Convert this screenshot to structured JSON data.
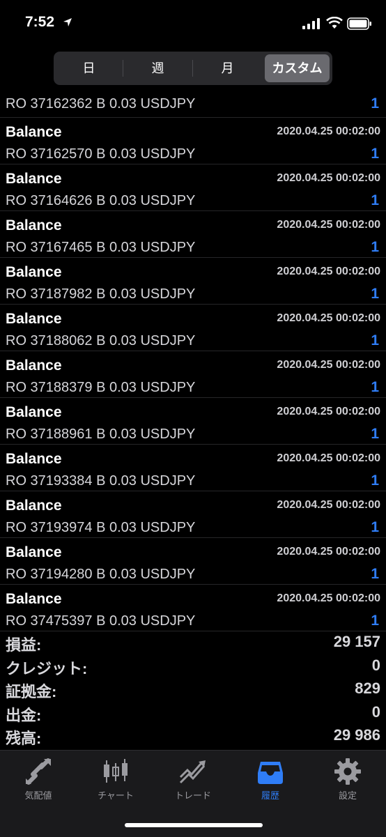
{
  "status": {
    "time": "7:52"
  },
  "segments": [
    {
      "label": "日"
    },
    {
      "label": "週"
    },
    {
      "label": "月"
    },
    {
      "label": "カスタム",
      "selected": true
    }
  ],
  "first_row": {
    "deal": "RO 37162362 B 0.03 USDJPY",
    "count": "1"
  },
  "rows": [
    {
      "title": "Balance",
      "time": "2020.04.25 00:02:00",
      "deal": "RO 37162570 B 0.03 USDJPY",
      "count": "1"
    },
    {
      "title": "Balance",
      "time": "2020.04.25 00:02:00",
      "deal": "RO 37164626 B 0.03 USDJPY",
      "count": "1"
    },
    {
      "title": "Balance",
      "time": "2020.04.25 00:02:00",
      "deal": "RO 37167465 B 0.03 USDJPY",
      "count": "1"
    },
    {
      "title": "Balance",
      "time": "2020.04.25 00:02:00",
      "deal": "RO 37187982 B 0.03 USDJPY",
      "count": "1"
    },
    {
      "title": "Balance",
      "time": "2020.04.25 00:02:00",
      "deal": "RO 37188062 B 0.03 USDJPY",
      "count": "1"
    },
    {
      "title": "Balance",
      "time": "2020.04.25 00:02:00",
      "deal": "RO 37188379 B 0.03 USDJPY",
      "count": "1"
    },
    {
      "title": "Balance",
      "time": "2020.04.25 00:02:00",
      "deal": "RO 37188961 B 0.03 USDJPY",
      "count": "1"
    },
    {
      "title": "Balance",
      "time": "2020.04.25 00:02:00",
      "deal": "RO 37193384 B 0.03 USDJPY",
      "count": "1"
    },
    {
      "title": "Balance",
      "time": "2020.04.25 00:02:00",
      "deal": "RO 37193974 B 0.03 USDJPY",
      "count": "1"
    },
    {
      "title": "Balance",
      "time": "2020.04.25 00:02:00",
      "deal": "RO 37194280 B 0.03 USDJPY",
      "count": "1"
    },
    {
      "title": "Balance",
      "time": "2020.04.25 00:02:00",
      "deal": "RO 37475397 B 0.03 USDJPY",
      "count": "1"
    }
  ],
  "summary": [
    {
      "label": "損益:",
      "value": "29 157"
    },
    {
      "label": "クレジット:",
      "value": "0"
    },
    {
      "label": "証拠金:",
      "value": "829"
    },
    {
      "label": "出金:",
      "value": "0"
    },
    {
      "label": "残高:",
      "value": "29 986"
    }
  ],
  "tabs": [
    {
      "label": "気配値",
      "icon": "quotes-arrows-icon"
    },
    {
      "label": "チャート",
      "icon": "candlestick-chart-icon"
    },
    {
      "label": "トレード",
      "icon": "trade-trend-icon"
    },
    {
      "label": "履歴",
      "icon": "history-tray-icon",
      "active": true
    },
    {
      "label": "設定",
      "icon": "gear-icon"
    }
  ],
  "colors": {
    "accent": "#2f7df6",
    "background": "#000000",
    "tabbar": "#1a1a1c"
  }
}
